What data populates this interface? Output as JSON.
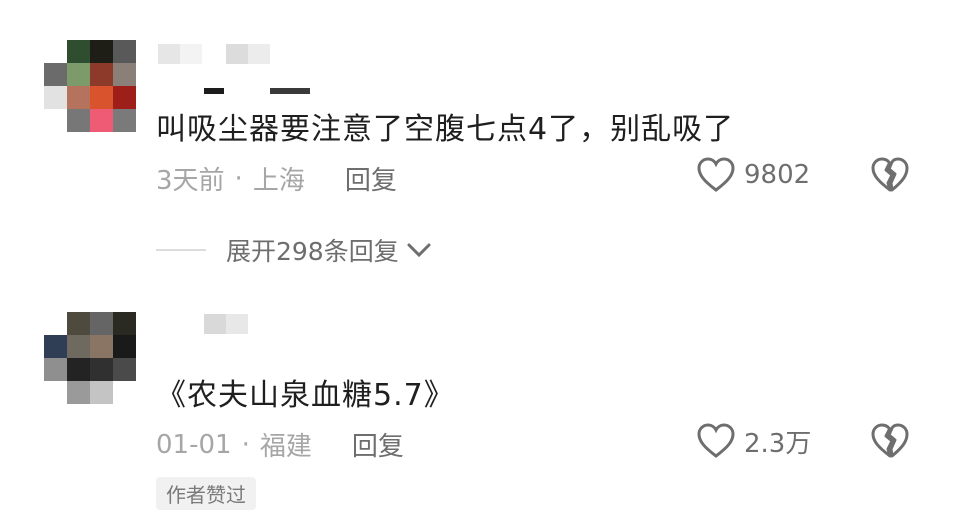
{
  "comments": [
    {
      "text": "叫吸尘器要注意了空腹七点4了，别乱吸了",
      "time": "3天前",
      "separator": "·",
      "location": "上海",
      "reply_label": "回复",
      "likes": "9802",
      "expand_label": "展开298条回复"
    },
    {
      "text": "《农夫山泉血糖5.7》",
      "time": "01-01",
      "separator": "·",
      "location": "福建",
      "reply_label": "回复",
      "likes": "2.3万",
      "badge": "作者赞过"
    }
  ],
  "icons": {
    "like": "heart-outline-icon",
    "dislike": "broken-heart-icon",
    "expand": "chevron-down-icon"
  },
  "colors": {
    "meta_text": "#a6a6a6",
    "icon": "#6e6e6e"
  }
}
